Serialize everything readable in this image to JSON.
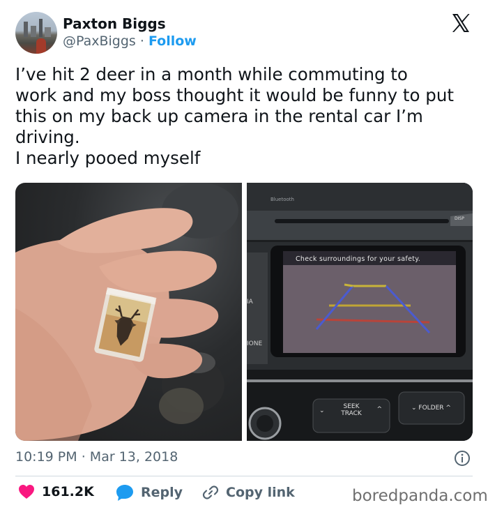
{
  "author": {
    "display_name": "Paxton Biggs",
    "handle": "@PaxBiggs",
    "separator": "·",
    "follow_label": "Follow"
  },
  "tweet": {
    "lines": [
      "I’ve hit 2 deer in a month while commuting to",
      "work and my boss thought it would be funny to put",
      "this on my back up camera in the rental car I’m",
      "driving.",
      "I nearly pooed myself"
    ]
  },
  "media": {
    "screen_text": "Check surroundings for your safety.",
    "bluetooth_label": "Bluetooth",
    "disp_label": "DISP",
    "side_label_a": "IA",
    "side_label_b": "IONE",
    "seek_track_label_1": "SEEK",
    "seek_track_label_2": "TRACK",
    "folder_label": "FOLDER"
  },
  "meta": {
    "time": "10:19 PM",
    "separator": "·",
    "date": "Mar 13, 2018"
  },
  "actions": {
    "likes_count": "161.2K",
    "reply_label": "Reply",
    "copy_link_label": "Copy link"
  },
  "watermark": "boredpanda.com",
  "colors": {
    "accent": "#1d9bf0",
    "like": "#f91880",
    "secondary_text": "#536471"
  },
  "icons": [
    "x-logo-icon",
    "info-icon",
    "heart-icon",
    "reply-bubble-icon",
    "link-icon"
  ]
}
